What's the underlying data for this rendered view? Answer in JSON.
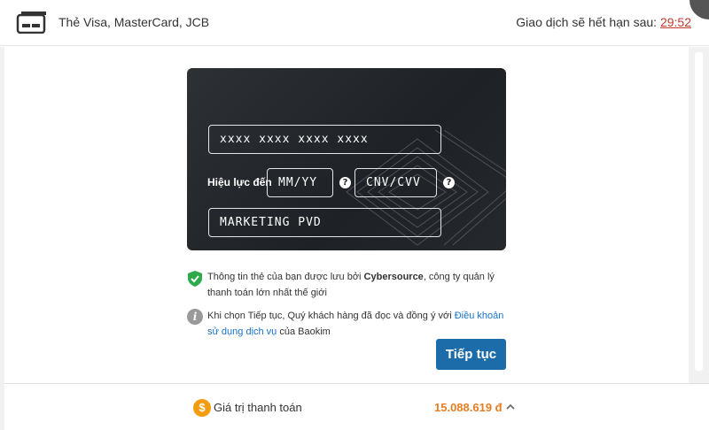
{
  "header": {
    "title": "Thẻ Visa, MasterCard, JCB",
    "expire_label": "Giao dịch sẽ hết hạn sau:",
    "timer": "29:52",
    "icon": "credit-card-icon"
  },
  "card_form": {
    "card_number_placeholder": "xxxx xxxx xxxx xxxx",
    "expiry_label": "Hiệu lực đến",
    "expiry_placeholder": "MM/YY",
    "cvv_placeholder": "CNV/CVV",
    "help_glyph": "?",
    "cardholder_value": "MARKETING PVD"
  },
  "security_note": {
    "text_before": "Thông tin thẻ của bạn được lưu bởi ",
    "brand": "Cybersource",
    "text_after": ", công ty quản lý thanh toán lớn nhất thế giới",
    "icon": "shield-check-icon"
  },
  "terms_note": {
    "text_before": "Khi chọn Tiếp tục, Quý khách hàng đã đọc và đồng ý với ",
    "link": "Điều khoản sử dụng dịch vụ",
    "text_after": " của Baokim",
    "icon": "info-icon",
    "icon_glyph": "i"
  },
  "continue_button": "Tiếp tục",
  "footer": {
    "label": "Giá trị thanh toán",
    "amount": "15.088.619 đ",
    "coin_glyph": "$",
    "icon": "dollar-coin-icon"
  },
  "colors": {
    "accent": "#1b6ca8",
    "amount": "#e67e22",
    "timer": "#c0392b",
    "card_bg": "#23262a"
  }
}
